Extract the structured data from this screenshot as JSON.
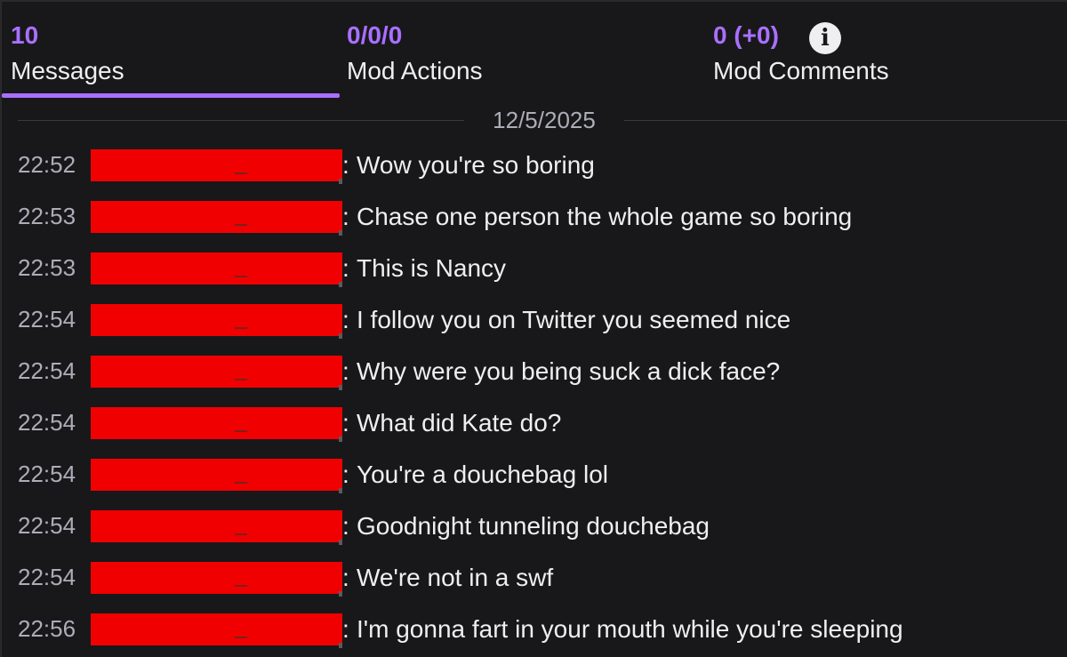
{
  "tabs": {
    "messages": {
      "count": "10",
      "label": "Messages"
    },
    "mod_actions": {
      "count": "0/0/0",
      "label": "Mod Actions"
    },
    "mod_comments": {
      "count": "0 (+0)",
      "label": "Mod Comments",
      "info_icon": "i"
    }
  },
  "date_separator": "12/5/2025",
  "colors": {
    "accent": "#a970ff",
    "redaction": "#f00000",
    "background": "#18181b"
  },
  "messages": [
    {
      "time": "22:52",
      "colon": ":",
      "text": "Wow you're so boring"
    },
    {
      "time": "22:53",
      "colon": ":",
      "text": "Chase one person the whole game so boring"
    },
    {
      "time": "22:53",
      "colon": ":",
      "text": "This is Nancy"
    },
    {
      "time": "22:54",
      "colon": ":",
      "text": "I follow you on Twitter you seemed nice"
    },
    {
      "time": "22:54",
      "colon": ":",
      "text": "Why were you being suck a dick face?"
    },
    {
      "time": "22:54",
      "colon": ":",
      "text": "What did Kate do?"
    },
    {
      "time": "22:54",
      "colon": ":",
      "text": "You're a douchebag lol"
    },
    {
      "time": "22:54",
      "colon": ":",
      "text": "Goodnight tunneling douchebag"
    },
    {
      "time": "22:54",
      "colon": ":",
      "text": "We're not in a swf"
    },
    {
      "time": "22:56",
      "colon": ":",
      "text": "I'm gonna fart in your mouth while you're sleeping"
    }
  ]
}
